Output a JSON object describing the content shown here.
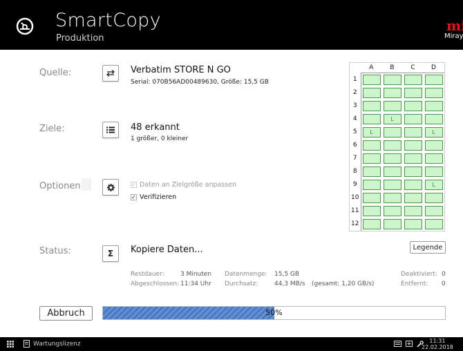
{
  "header": {
    "title": "SmartCopy",
    "subtitle": "Produktion",
    "brand_mark": "mi",
    "brand_name": "Miray"
  },
  "source": {
    "label": "Quelle:",
    "device": "Verbatim STORE N GO",
    "details": "Serial: 070B56AD00489630, Größe: 15,5 GB",
    "button_icon": "swap-icon"
  },
  "targets": {
    "label": "Ziele:",
    "count_text": "48 erkannt",
    "details": "1 größer, 0 kleiner",
    "button_icon": "list-icon"
  },
  "options": {
    "label": "Optionen:",
    "button_icon": "gear-icon",
    "items": [
      {
        "label": "Daten an Zielgröße anpassen",
        "checked": true,
        "disabled": true
      },
      {
        "label": "Verifizieren",
        "checked": true,
        "disabled": false
      }
    ]
  },
  "status": {
    "label": "Status:",
    "text": "Kopiere Daten...",
    "button_icon": "sigma-icon",
    "stats": {
      "remaining_label": "Restdauer:",
      "remaining_value": "3 Minuten",
      "completed_label": "Abgeschlossen:",
      "completed_value": "11:34 Uhr",
      "data_label": "Datenmenge:",
      "data_value": "15,5 GB",
      "throughput_label": "Durchsatz:",
      "throughput_value": "44,3 MB/s",
      "total_value": "(gesamt:  1,20 GB/s)",
      "deactivated_label": "Deaktiviert:",
      "deactivated_value": "0",
      "removed_label": "Entfernt:",
      "removed_value": "0"
    }
  },
  "grid": {
    "columns": [
      "A",
      "B",
      "C",
      "D"
    ],
    "rows": [
      "1",
      "2",
      "3",
      "4",
      "5",
      "6",
      "7",
      "8",
      "9",
      "10",
      "11",
      "12"
    ],
    "marks": {
      "4": {
        "B": "L"
      },
      "5": {
        "A": "L",
        "D": "L"
      },
      "9": {
        "D": "L"
      }
    }
  },
  "legend_label": "Legende",
  "abort_label": "Abbruch",
  "progress": {
    "percent": 50,
    "text": "50%"
  },
  "taskbar": {
    "app_label": "Wartungslizenz",
    "time": "11:31",
    "date": "22.02.2018"
  },
  "colors": {
    "slot_fill": "#ccf5cc",
    "slot_border": "#4a9a4a",
    "progress": "#4a78c2",
    "brand": "#e3151a"
  }
}
